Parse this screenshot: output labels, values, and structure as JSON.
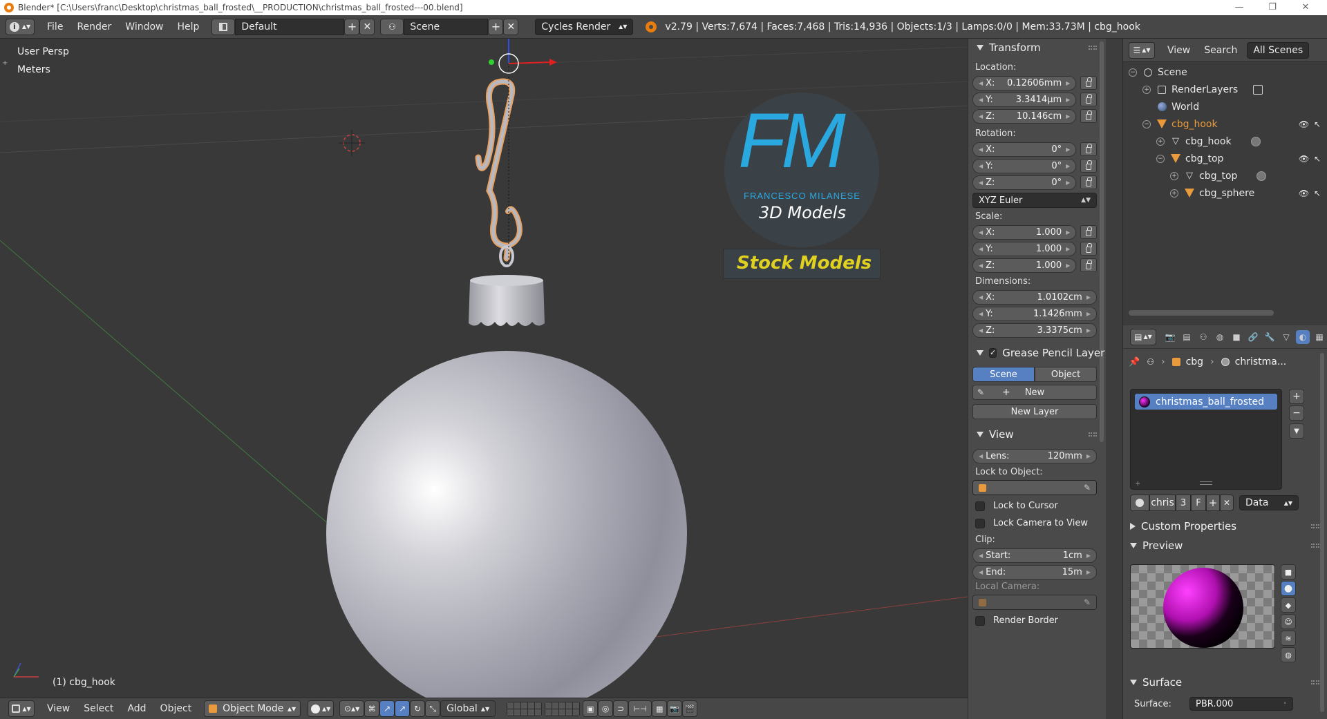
{
  "window": {
    "title": "Blender* [C:\\Users\\franc\\Desktop\\christmas_ball_frosted\\__PRODUCTION\\christmas_ball_frosted---00.blend]",
    "minimize": "—",
    "maximize": "❐",
    "close": "✕"
  },
  "header": {
    "menus": [
      "File",
      "Render",
      "Window",
      "Help"
    ],
    "layout": "Default",
    "scene": "Scene",
    "engine": "Cycles Render",
    "stats": "v2.79 | Verts:7,674 | Faces:7,468 | Tris:14,936 | Objects:1/3 | Lamps:0/0 | Mem:33.73M | cbg_hook"
  },
  "viewport": {
    "view_name": "User Persp",
    "units": "Meters",
    "active_object": "(1) cbg_hook",
    "watermark": {
      "monogram": "FM",
      "author": "FRANCESCO MILANESE",
      "subtitle": "3D Models",
      "banner": "Stock Models"
    }
  },
  "view3d_header": {
    "menus": [
      "View",
      "Select",
      "Add",
      "Object"
    ],
    "mode": "Object Mode",
    "orientation": "Global"
  },
  "npanel": {
    "transform": {
      "title": "Transform",
      "location_label": "Location:",
      "location": [
        {
          "axis": "X:",
          "value": "0.12606mm"
        },
        {
          "axis": "Y:",
          "value": "3.3414µm"
        },
        {
          "axis": "Z:",
          "value": "10.146cm"
        }
      ],
      "rotation_label": "Rotation:",
      "rotation": [
        {
          "axis": "X:",
          "value": "0°"
        },
        {
          "axis": "Y:",
          "value": "0°"
        },
        {
          "axis": "Z:",
          "value": "0°"
        }
      ],
      "rotation_mode": "XYZ Euler",
      "scale_label": "Scale:",
      "scale": [
        {
          "axis": "X:",
          "value": "1.000"
        },
        {
          "axis": "Y:",
          "value": "1.000"
        },
        {
          "axis": "Z:",
          "value": "1.000"
        }
      ],
      "dimensions_label": "Dimensions:",
      "dimensions": [
        {
          "axis": "X:",
          "value": "1.0102cm"
        },
        {
          "axis": "Y:",
          "value": "1.1426mm"
        },
        {
          "axis": "Z:",
          "value": "3.3375cm"
        }
      ]
    },
    "grease_pencil": {
      "title": "Grease Pencil Layer",
      "scene_btn": "Scene",
      "object_btn": "Object",
      "new_btn": "New",
      "new_layer_btn": "New Layer"
    },
    "view": {
      "title": "View",
      "lens_label": "Lens:",
      "lens_value": "120mm",
      "lock_to_object": "Lock to Object:",
      "lock_to_cursor": "Lock to Cursor",
      "lock_camera": "Lock Camera to View",
      "clip_label": "Clip:",
      "clip_start_label": "Start:",
      "clip_start": "1cm",
      "clip_end_label": "End:",
      "clip_end": "15m",
      "local_camera": "Local Camera:",
      "render_border": "Render Border"
    }
  },
  "outliner": {
    "menus": [
      "View",
      "Search"
    ],
    "filter": "All Scenes",
    "items": [
      {
        "label": "Scene"
      },
      {
        "label": "RenderLayers"
      },
      {
        "label": "World"
      },
      {
        "label": "cbg_hook"
      },
      {
        "label": "cbg_hook"
      },
      {
        "label": "cbg_top"
      },
      {
        "label": "cbg_top"
      },
      {
        "label": "cbg_sphere"
      }
    ]
  },
  "properties": {
    "breadcrumb_object": "cbg",
    "breadcrumb_material": "christma...",
    "material_slot": "christmas_ball_frosted",
    "material_name_short": "chris",
    "users": "3",
    "fake_user": "F",
    "link_mode": "Data",
    "custom_properties": "Custom Properties",
    "preview": "Preview",
    "surface_title": "Surface",
    "surface_label": "Surface:",
    "surface_value": "PBR.000"
  },
  "colors": {
    "accent": "#5680c2",
    "object_orange": "#e89a3c",
    "watermark_blue": "#2aa8e0",
    "watermark_yellow": "#e0d020"
  }
}
